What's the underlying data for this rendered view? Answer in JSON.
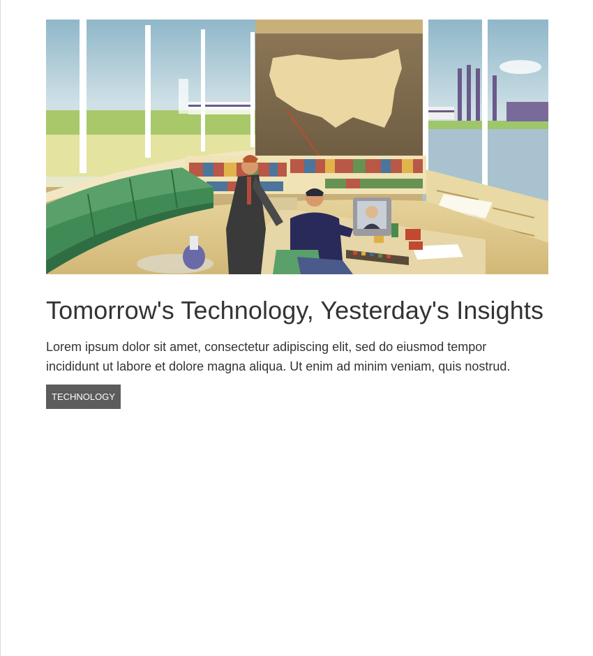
{
  "article": {
    "title": "Tomorrow's Technology, Yesterday's Insights",
    "excerpt": "Lorem ipsum dolor sit amet, consectetur adipiscing elit, sed do eiusmod tempor incididunt ut labore et dolore magna aliqua. Ut enim ad minim veniam, quis nostrud.",
    "tag": "TECHNOLOGY"
  },
  "colors": {
    "tag_background": "#5c5c5c",
    "text": "#333333"
  }
}
